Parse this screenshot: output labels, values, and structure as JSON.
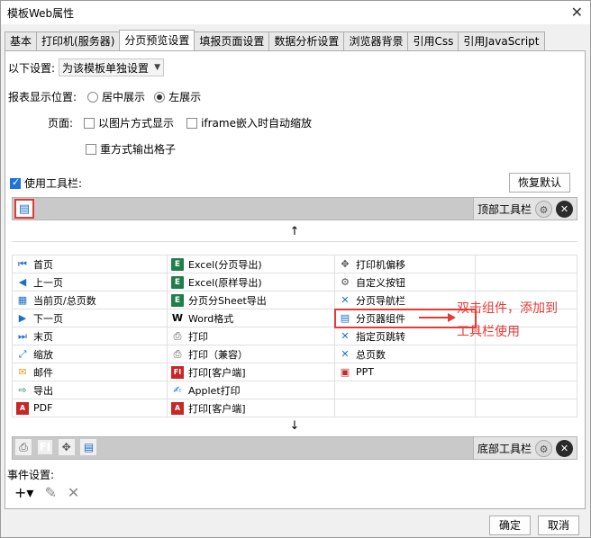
{
  "window": {
    "title": "模板Web属性",
    "close_glyph": "✕"
  },
  "tabs": [
    {
      "label": "基本",
      "active": false
    },
    {
      "label": "打印机(服务器)",
      "active": false
    },
    {
      "label": "分页预览设置",
      "active": true
    },
    {
      "label": "填报页面设置",
      "active": false
    },
    {
      "label": "数据分析设置",
      "active": false
    },
    {
      "label": "浏览器背景",
      "active": false
    },
    {
      "label": "引用Css",
      "active": false
    },
    {
      "label": "引用JavaScript",
      "active": false
    }
  ],
  "settings": {
    "scope_label": "以下设置:",
    "scope_value": "为该模板单独设置",
    "position_label": "报表显示位置:",
    "position_center": "居中展示",
    "position_left": "左展示",
    "page_label": "页面:",
    "image_mode": "以图片方式显示",
    "iframe_zoom": "iframe嵌入时自动缩放",
    "square_grid": "重方式输出格子",
    "use_toolbar": "使用工具栏:",
    "restore_default": "恢复默认"
  },
  "top_toolbar": {
    "label": "顶部工具栏"
  },
  "bottom_toolbar": {
    "label": "底部工具栏"
  },
  "arrows": {
    "up": "↑",
    "down": "↓"
  },
  "buttons": {
    "col1": [
      "首页",
      "上一页",
      "当前页/总页数",
      "下一页",
      "末页",
      "缩放",
      "邮件",
      "导出",
      "PDF"
    ],
    "col2": [
      "Excel(分页导出)",
      "Excel(原样导出)",
      "分页分Sheet导出",
      "Word格式",
      "打印",
      "打印（兼容）",
      "打印[客户端]",
      "Applet打印",
      "打印[客户端]"
    ],
    "col3": [
      "打印机偏移",
      "自定义按钮",
      "分页导航栏",
      "分页器组件",
      "指定页跳转",
      "总页数",
      "PPT"
    ]
  },
  "annotation": {
    "line1": "双击组件，添加到",
    "line2": "工具栏使用"
  },
  "events": {
    "label": "事件设置:",
    "add_glyph": "+▾",
    "edit_glyph": "✎",
    "delete_glyph": "✕"
  },
  "footer": {
    "ok": "确定",
    "cancel": "取消"
  },
  "colors": {
    "accent": "#1e73d8",
    "highlight": "#e53935"
  }
}
